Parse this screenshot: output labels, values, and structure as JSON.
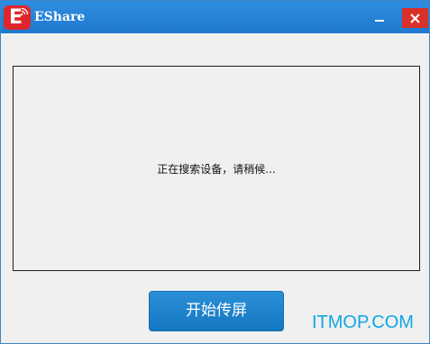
{
  "window": {
    "title": "EShare",
    "logo_letter": "E"
  },
  "controls": {
    "minimize_icon": "minimize-icon",
    "close_icon": "close-icon"
  },
  "search_panel": {
    "status": "正在搜索设备，请稍候..."
  },
  "actions": {
    "start_label": "开始传屏"
  },
  "watermark": "ITMOP.COM",
  "colors": {
    "titlebar": "#1f79cf",
    "close": "#d9302a",
    "logo": "#e0262b",
    "button": "#1a82cc",
    "watermark": "#0fa6e6"
  }
}
